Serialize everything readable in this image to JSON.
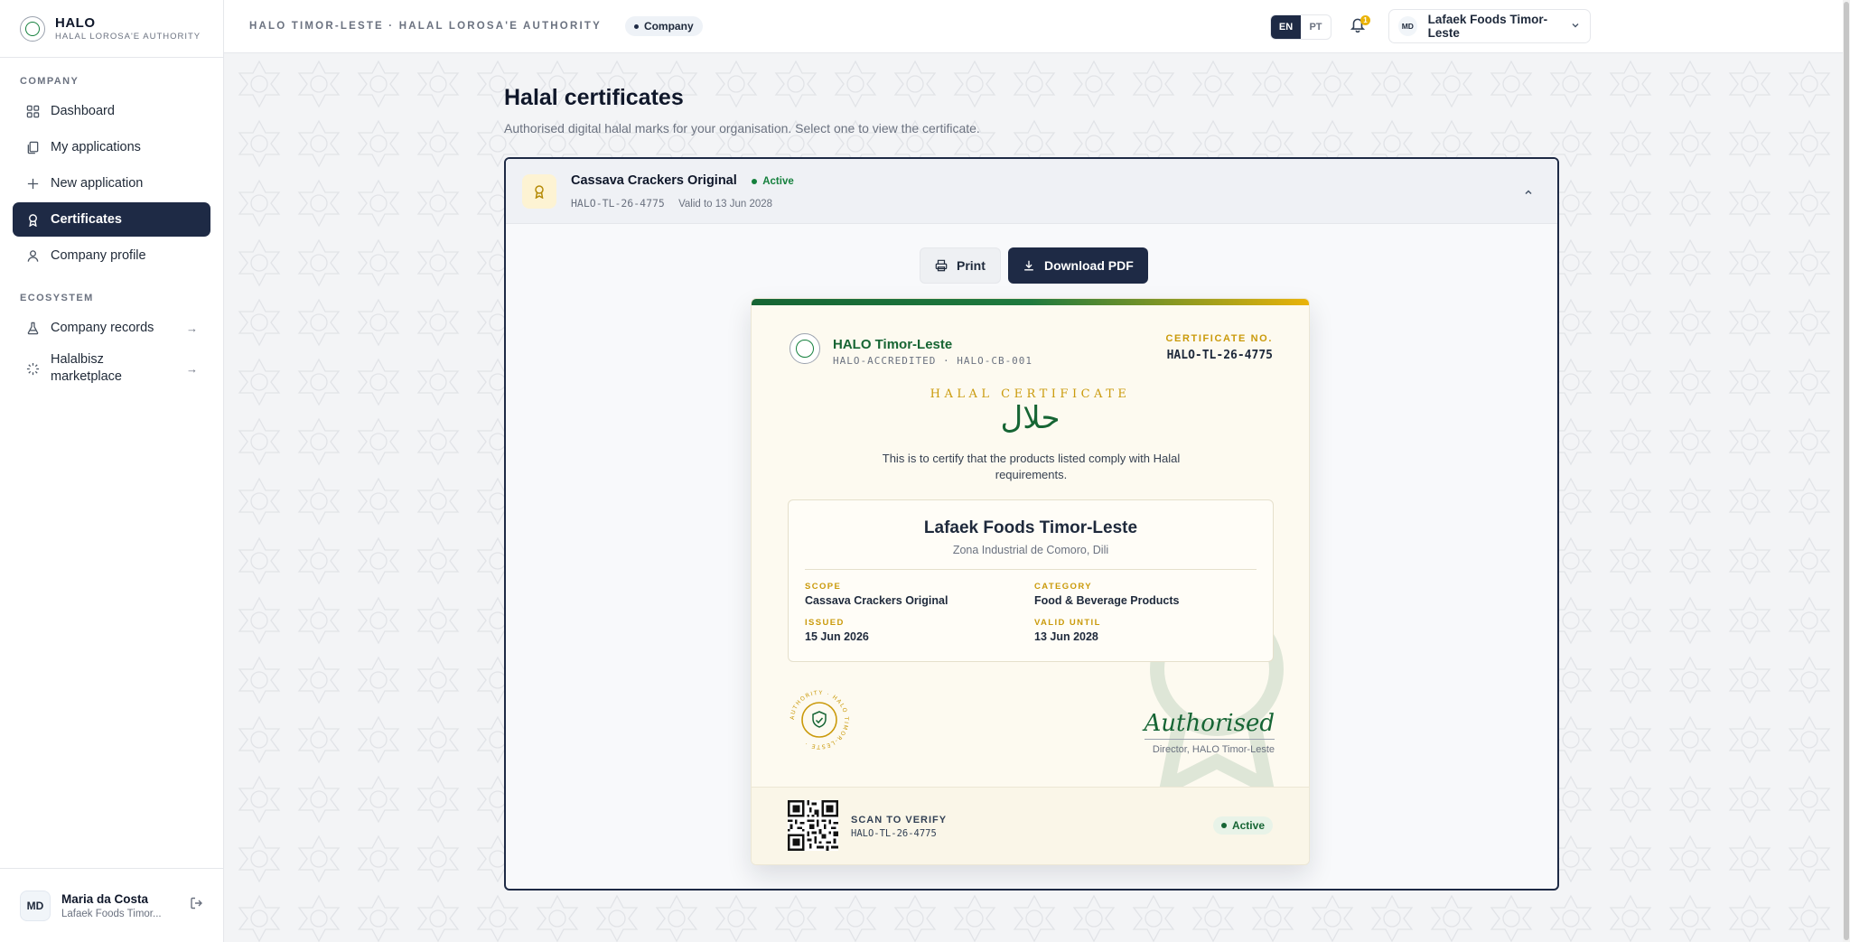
{
  "brand": {
    "name": "HALO",
    "subtitle": "HALAL LOROSA'E AUTHORITY"
  },
  "sidebar": {
    "sections": [
      {
        "label": "COMPANY"
      },
      {
        "label": "ECOSYSTEM"
      }
    ],
    "items": [
      {
        "label": "Dashboard",
        "icon": "grid-icon",
        "active": false
      },
      {
        "label": "My applications",
        "icon": "copy-icon",
        "active": false
      },
      {
        "label": "New application",
        "icon": "plus-icon",
        "active": false
      },
      {
        "label": "Certificates",
        "icon": "award-icon",
        "active": true
      },
      {
        "label": "Company profile",
        "icon": "user-icon",
        "active": false
      },
      {
        "label": "Company records",
        "icon": "flask-icon",
        "active": false
      },
      {
        "label": "Halalbisz marketplace",
        "icon": "sparkle-icon",
        "active": false
      }
    ],
    "user": {
      "initials": "MD",
      "name": "Maria da Costa",
      "org": "Lafaek Foods Timor..."
    }
  },
  "topbar": {
    "breadcrumb": "HALO TIMOR-LESTE · HALAL LOROSA'E AUTHORITY",
    "role_pill": "Company",
    "lang": [
      "EN",
      "PT"
    ],
    "lang_selected": "EN",
    "notif_count": "1",
    "org_initials": "MD",
    "org_name": "Lafaek Foods Timor-Leste"
  },
  "page": {
    "title": "Halal certificates",
    "subtitle": "Authorised digital halal marks for your organisation. Select one to view the certificate."
  },
  "certificate_item": {
    "name": "Cassava Crackers Original",
    "status": "Active",
    "number": "HALO-TL-26-4775",
    "valid": "Valid to 13 Jun 2028"
  },
  "actions": {
    "print": "Print",
    "download": "Download PDF"
  },
  "certificate": {
    "org": "HALO Timor-Leste",
    "accreditation": "HALO-ACCREDITED · HALO-CB-001",
    "no_label": "CERTIFICATE NO.",
    "no": "HALO-TL-26-4775",
    "title": "HALAL CERTIFICATE",
    "arabic": "حلال",
    "statement": "This is to certify that the products listed comply with Halal requirements.",
    "company": "Lafaek Foods Timor-Leste",
    "address": "Zona Industrial de Comoro, Dili",
    "scope_label": "SCOPE",
    "scope": "Cassava Crackers Original",
    "category_label": "CATEGORY",
    "category": "Food & Beverage Products",
    "issued_label": "ISSUED",
    "issued": "15 Jun 2026",
    "valid_label": "VALID UNTIL",
    "valid": "13 Jun 2028",
    "seal_text": "AUTHORITY · HALO TIMOR-LESTE ·",
    "signature": "Authorised",
    "signatory": "Director, HALO Timor-Leste",
    "scan_label": "SCAN TO VERIFY",
    "scan_no": "HALO-TL-26-4775",
    "status": "Active"
  },
  "colors": {
    "navy": "#1e2a45",
    "green": "#166534",
    "gold": "#ca9a0b"
  }
}
